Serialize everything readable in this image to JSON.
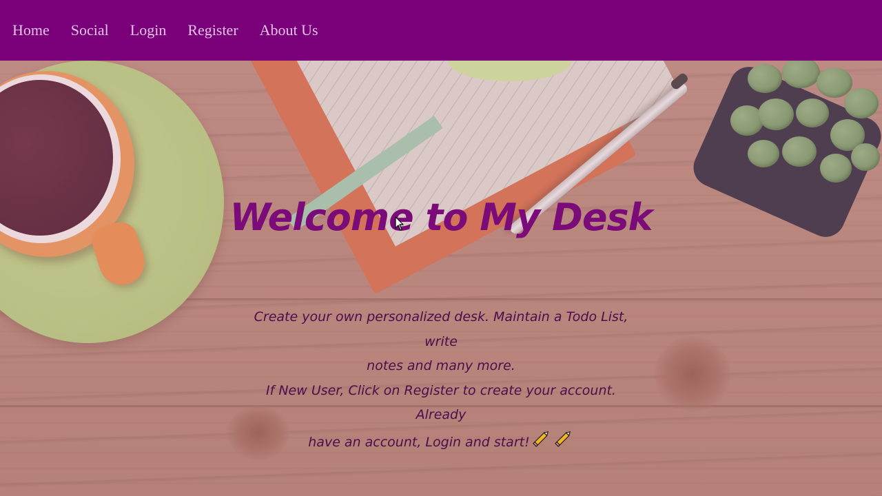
{
  "nav": {
    "items": [
      {
        "label": "Home"
      },
      {
        "label": "Social"
      },
      {
        "label": "Login"
      },
      {
        "label": "Register"
      },
      {
        "label": "About Us"
      }
    ]
  },
  "hero": {
    "title": "Welcome to My Desk",
    "description_lines": [
      "Create your own personalized desk. Maintain a Todo List, write",
      "notes and many more.",
      "If New User, Click on Register to create your account. Already",
      "have an account, Login and start!"
    ],
    "trailing_icons": [
      "pencil-icon",
      "pencil-icon"
    ]
  },
  "colors": {
    "navbar_bg": "#790079",
    "nav_text": "#e6c3ea",
    "title": "#7a0b78",
    "description": "#4b0d4c"
  }
}
